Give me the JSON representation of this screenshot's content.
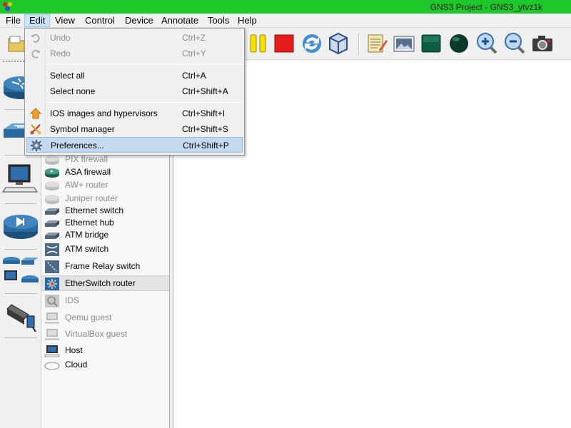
{
  "window": {
    "title": "GNS3 Project - GNS3_ytvz1k"
  },
  "menubar": {
    "items": [
      "File",
      "Edit",
      "View",
      "Control",
      "Device",
      "Annotate",
      "Tools",
      "Help"
    ],
    "active": "Edit"
  },
  "toolbar": {
    "buttons": [
      "open-folder-icon",
      "pause-icon",
      "stop-icon",
      "reload-icon",
      "virtualbox-icon",
      "note-icon",
      "picture-icon",
      "rectangle-icon",
      "ellipse-icon",
      "zoom-in-icon",
      "zoom-out-icon",
      "screenshot-icon"
    ]
  },
  "edit_menu": {
    "items": [
      {
        "label": "Undo",
        "shortcut": "Ctrl+Z",
        "enabled": false
      },
      {
        "label": "Redo",
        "shortcut": "Ctrl+Y",
        "enabled": false
      },
      {
        "label": "Select all",
        "shortcut": "Ctrl+A",
        "enabled": true
      },
      {
        "label": "Select none",
        "shortcut": "Ctrl+Shift+A",
        "enabled": true
      },
      {
        "label": "IOS images and hypervisors",
        "shortcut": "Ctrl+Shift+I",
        "enabled": true
      },
      {
        "label": "Symbol manager",
        "shortcut": "Ctrl+Shift+S",
        "enabled": true
      },
      {
        "label": "Preferences...",
        "shortcut": "Ctrl+Shift+P",
        "enabled": true,
        "highlighted": true
      }
    ]
  },
  "device_list": {
    "items": [
      {
        "label": "PIX firewall",
        "enabled": false
      },
      {
        "label": "ASA firewall",
        "enabled": true
      },
      {
        "label": "AW+ router",
        "enabled": false
      },
      {
        "label": "Juniper router",
        "enabled": false
      },
      {
        "label": "Ethernet switch",
        "enabled": true
      },
      {
        "label": "Ethernet hub",
        "enabled": true
      },
      {
        "label": "ATM bridge",
        "enabled": true
      },
      {
        "label": "ATM switch",
        "enabled": true
      },
      {
        "label": "Frame Relay switch",
        "enabled": true
      },
      {
        "label": "EtherSwitch router",
        "enabled": true,
        "highlighted": true
      },
      {
        "label": "IDS",
        "enabled": false
      },
      {
        "label": "Qemu guest",
        "enabled": false
      },
      {
        "label": "VirtualBox guest",
        "enabled": false
      },
      {
        "label": "Host",
        "enabled": true
      },
      {
        "label": "Cloud",
        "enabled": true
      }
    ]
  },
  "colors": {
    "titlebar": "#1ec72a",
    "menu_highlight": "#c5d9ee",
    "disabled_text": "#8a8a8a"
  }
}
